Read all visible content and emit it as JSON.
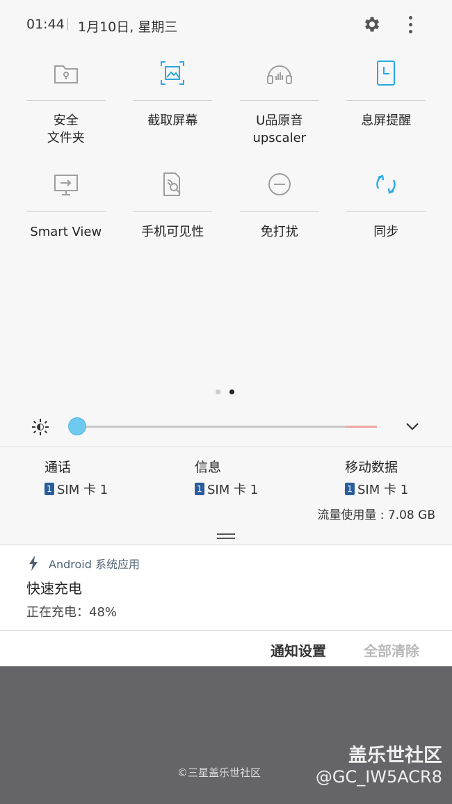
{
  "status": {
    "time": "01:44",
    "date": "1月10日, 星期三"
  },
  "header_icons": [
    "gear-icon",
    "more-vert-icon"
  ],
  "tiles": [
    {
      "label": "安全\n文件夹",
      "icon": "secure-folder-icon",
      "active": false
    },
    {
      "label": "截取屏幕",
      "icon": "screenshot-icon",
      "active": true
    },
    {
      "label": "U品原音\nupscaler",
      "icon": "headphones-icon",
      "active": false
    },
    {
      "label": "息屏提醒",
      "icon": "always-on-display-icon",
      "active": true
    },
    {
      "label": "Smart View",
      "icon": "smart-view-icon",
      "active": false
    },
    {
      "label": "手机可见性",
      "icon": "phone-visibility-icon",
      "active": false
    },
    {
      "label": "免打扰",
      "icon": "do-not-disturb-icon",
      "active": false
    },
    {
      "label": "同步",
      "icon": "sync-icon",
      "active": true
    }
  ],
  "pager": {
    "count": 2,
    "current": 2
  },
  "brightness": {
    "level": 0.0
  },
  "sim": [
    {
      "title": "通话",
      "badge": "1",
      "card": "SIM 卡 1"
    },
    {
      "title": "信息",
      "badge": "1",
      "card": "SIM 卡 1"
    },
    {
      "title": "移动数据",
      "badge": "1",
      "card": "SIM 卡 1"
    }
  ],
  "data_usage": "流量使用量 : 7.08 GB",
  "notification": {
    "app": "Android 系统应用",
    "title": "快速充电",
    "text": "正在充电：48%"
  },
  "actions": {
    "settings": "通知设置",
    "clear_all": "全部清除"
  },
  "footer": {
    "copyright": "©三星盖乐世社区",
    "watermark_title": "盖乐世社区",
    "watermark_user": "@GC_IW5ACR8"
  },
  "colors": {
    "accent": "#27a9e1",
    "icon_inactive": "#9e9e9e",
    "sim_badge": "#2a5d9a",
    "backdrop": "#656569"
  }
}
